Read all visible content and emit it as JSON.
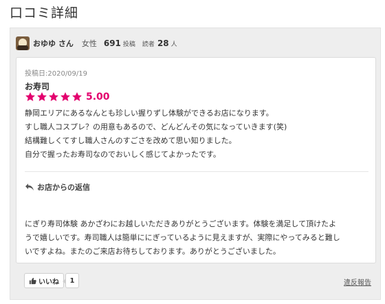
{
  "page": {
    "title": "口コミ詳細"
  },
  "reviewer": {
    "name": "おゆゆ さん",
    "gender": "女性",
    "posts_count": "691",
    "posts_label": "投稿",
    "readers_label": "読者",
    "readers_count": "28",
    "readers_unit": "人"
  },
  "review": {
    "post_date": "投稿日:2020/09/19",
    "shop_name": "お寿司",
    "rating": "5.00",
    "star_count": 5,
    "star_color": "#e3006e",
    "body_lines": [
      "静岡エリアにあるなんとも珍しい握りずし体験ができるお店になります。",
      "すし職人コスプレ？の用意もあるので、どんどんその気になっていきます(笑)",
      "結構難しくてすし職人さんのすごさを改めて思い知りました。",
      "自分で握ったお寿司なのでおいしく感じてよかったです。"
    ]
  },
  "reply": {
    "heading": "お店からの返信",
    "icon": "reply-arrow-icon",
    "body_lines": [
      "にぎり寿司体験 あかざわにお越しいただきありがとうございます。体験を満足して頂けたよ",
      "うで嬉しいです。寿司職人は簡単ににぎっているように見えますが、実際にやってみると難し",
      "いですよね。またのご来店お待ちしております。ありがとうございました。"
    ]
  },
  "footer": {
    "like_label": "いいね",
    "like_icon": "thumbs-up-icon",
    "like_count": "1",
    "report_label": "違反報告"
  }
}
